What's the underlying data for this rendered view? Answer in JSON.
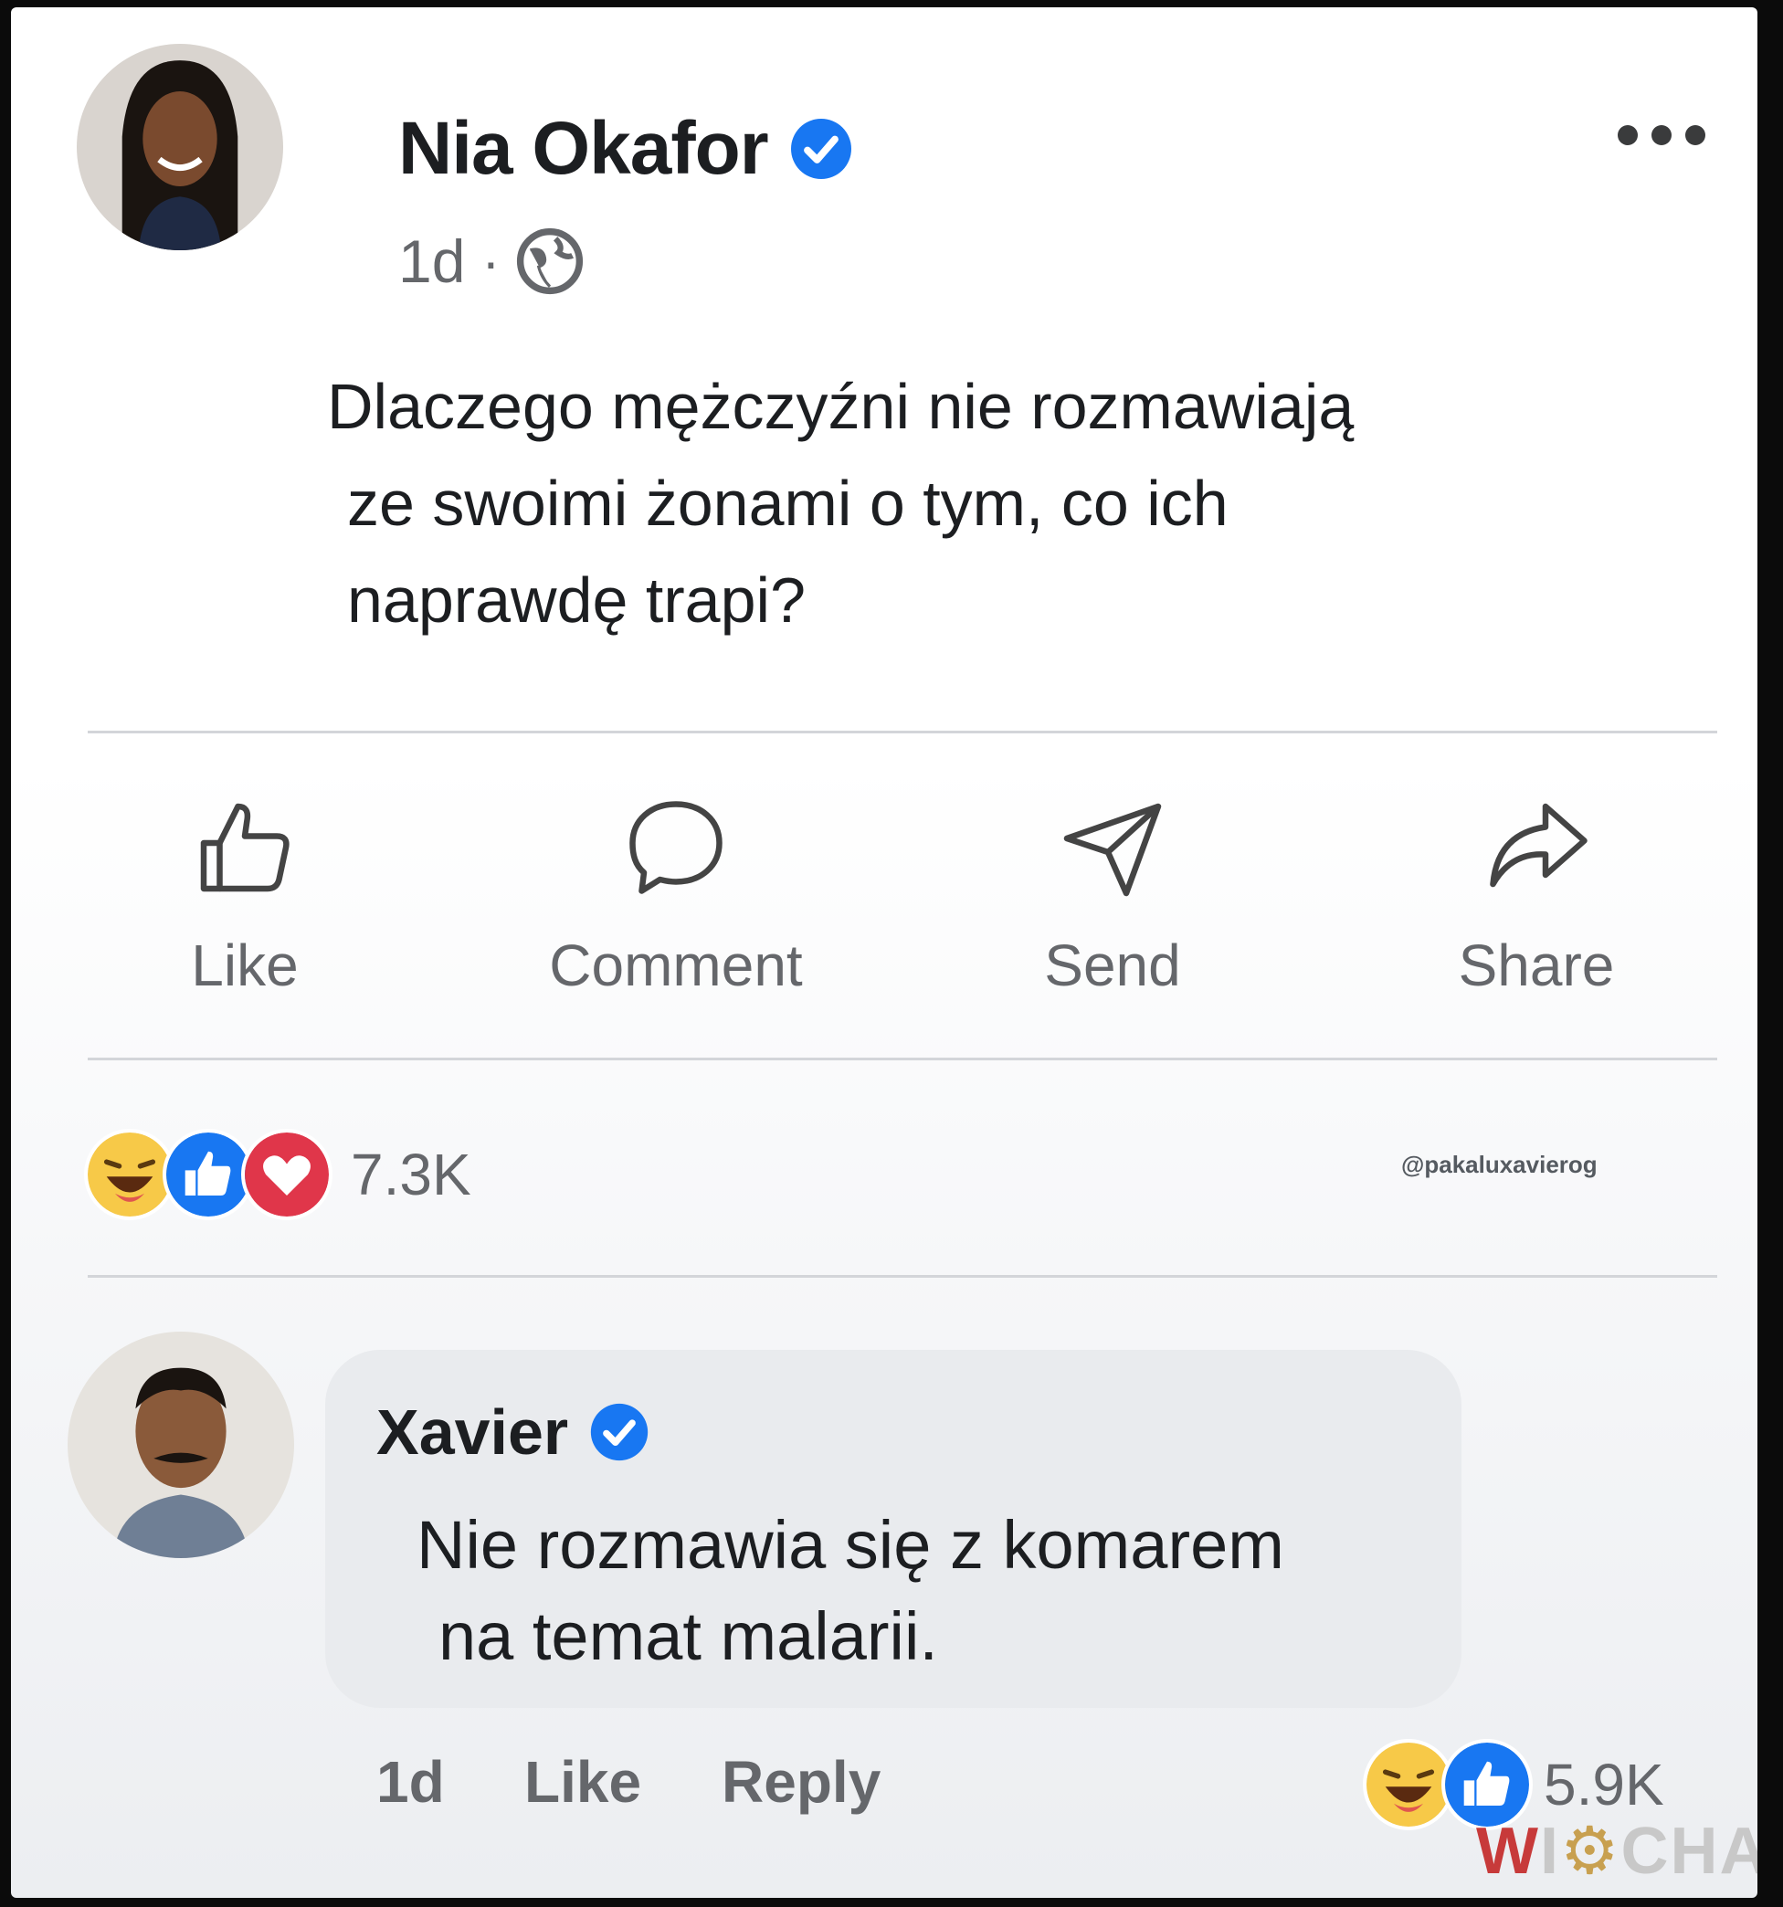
{
  "post": {
    "author": "Nia Okafor",
    "time": "1d",
    "separator": "·",
    "text_lines": [
      "Dlaczego mężczyźni nie rozmawiają",
      "ze swoimi żonami o tym, co ich",
      "naprawdę trapi?"
    ]
  },
  "actions": [
    {
      "label": "Like",
      "icon": "thumbs-up-icon"
    },
    {
      "label": "Comment",
      "icon": "speech-bubble-icon"
    },
    {
      "label": "Send",
      "icon": "paper-plane-icon"
    },
    {
      "label": "Share",
      "icon": "share-arrow-icon"
    }
  ],
  "reactions": {
    "icons": [
      "haha-icon",
      "like-icon",
      "love-icon"
    ],
    "count": "7.3K",
    "handle": "@pakaluxavierog"
  },
  "comment": {
    "author": "Xavier",
    "text_lines": [
      "Nie rozmawia się z komarem",
      "na temat malarii."
    ],
    "time": "1d",
    "like_label": "Like",
    "reply_label": "Reply",
    "reaction_icons": [
      "haha-icon",
      "like-icon"
    ],
    "reaction_count": "5.9K"
  },
  "watermark": {
    "first": "W",
    "rest": "I",
    "tail": "CHA"
  },
  "colors": {
    "verified": "#1877f2",
    "text": "#1c1e21",
    "secondary": "#65676b",
    "bubble": "#e9ebee"
  }
}
